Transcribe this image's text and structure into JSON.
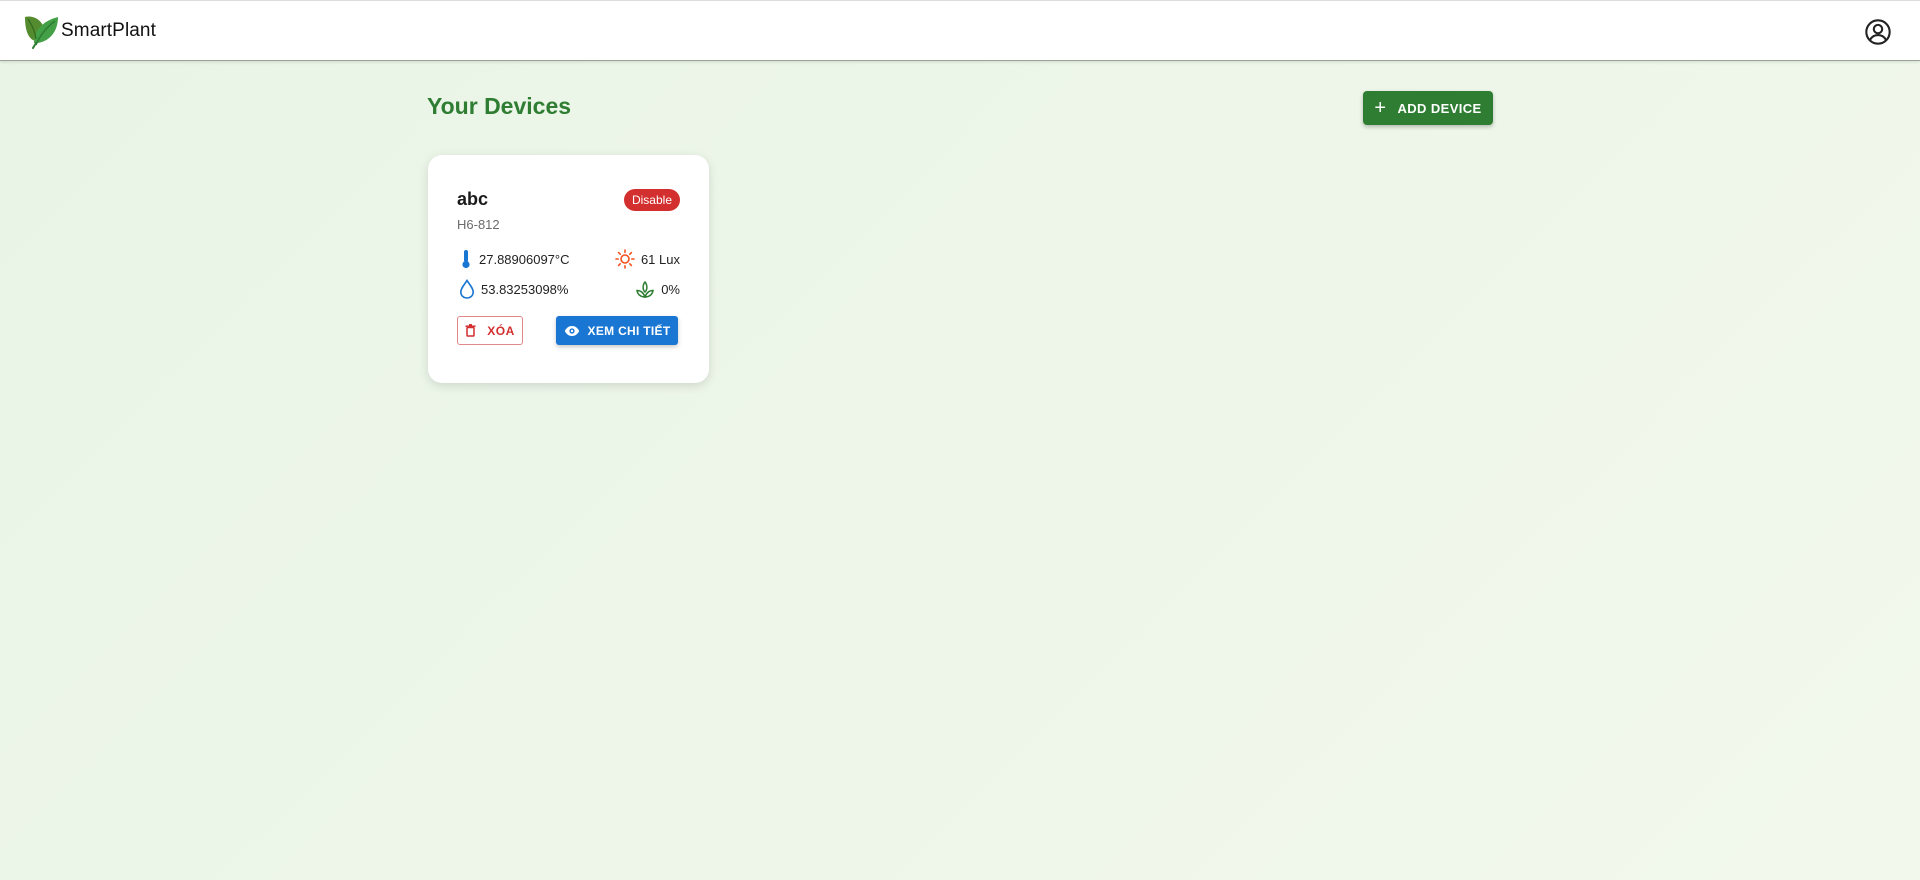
{
  "header": {
    "brand_name": "SmartPlant",
    "logo_icon": "leaf-logo-icon",
    "account_icon": "account-circle-icon"
  },
  "main": {
    "title": "Your Devices",
    "add_button_icon": "+",
    "add_button_label": "ADD DEVICE"
  },
  "devices": [
    {
      "name": "abc",
      "status": "Disable",
      "code": "H6-812",
      "temperature": "27.88906097°C",
      "light": "61 Lux",
      "humidity": "53.83253098%",
      "soil_moisture": "0%",
      "delete_label": "XÓA",
      "detail_label": "XEM CHI TIẾT"
    }
  ],
  "colors": {
    "primary_green": "#2e7d32",
    "danger_red": "#d32f2f",
    "info_blue": "#1976d2",
    "sun_orange": "#f4511e"
  }
}
